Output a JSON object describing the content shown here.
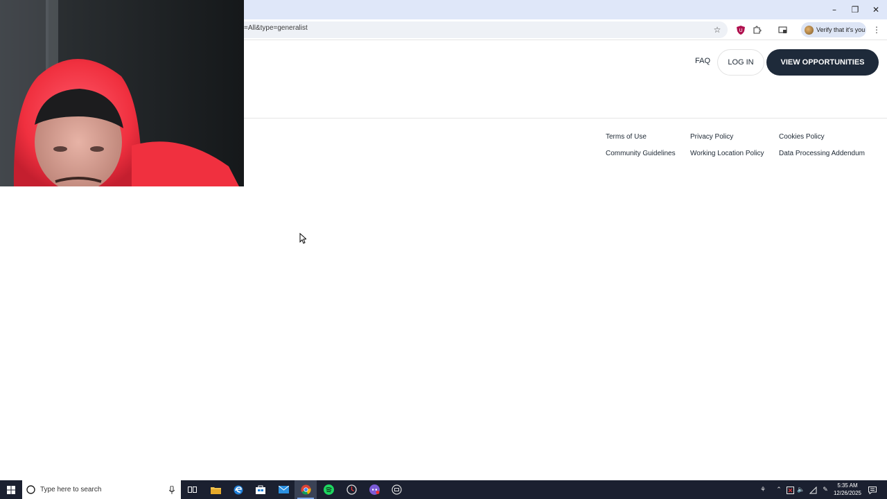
{
  "browser": {
    "url_fragment": "=All&type=generalist",
    "profile_chip": "Verify that it's you",
    "icons": [
      "minimize-icon",
      "restore-icon",
      "close-icon",
      "star-icon",
      "shield-extension-icon",
      "puzzle-icon",
      "cast-icon",
      "kebab-menu-icon"
    ]
  },
  "header": {
    "faq": "FAQ",
    "login": "LOG IN",
    "cta": "VIEW OPPORTUNITIES"
  },
  "footer": {
    "links": [
      "Terms of Use",
      "Privacy Policy",
      "Cookies Policy",
      "Community Guidelines",
      "Working Location Policy",
      "Data Processing Addendum"
    ]
  },
  "taskbar": {
    "search_placeholder": "Type here to search",
    "time": "5:35 AM",
    "date": "12/26/2025",
    "apps": [
      "task-view-icon",
      "file-explorer-icon",
      "edge-icon",
      "store-icon",
      "mail-icon",
      "chrome-icon",
      "spotify-icon",
      "app-icon",
      "discord-icon",
      "app-icon"
    ]
  },
  "colors": {
    "cta_bg": "#1e2a3a",
    "titlebar_bg": "#dfe7f9",
    "taskbar_bg": "#1b2030"
  }
}
